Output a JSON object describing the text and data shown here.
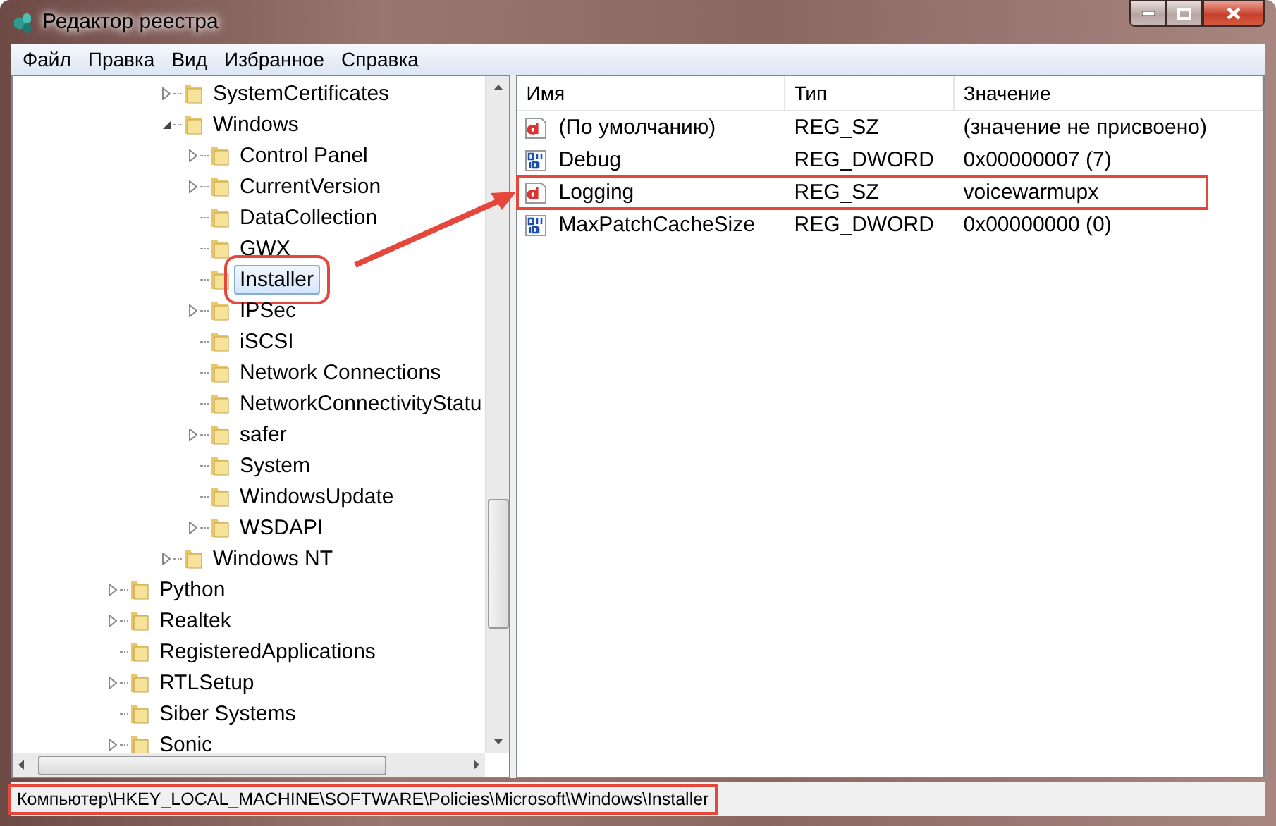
{
  "window": {
    "title": "Редактор реестра"
  },
  "menu": [
    "Файл",
    "Правка",
    "Вид",
    "Избранное",
    "Справка"
  ],
  "tree": {
    "items": [
      {
        "kind": "hidden",
        "children": [
          {
            "kind": "hidden",
            "children": [
              {
                "label": "SystemCertificates",
                "kind": "collapsed",
                "selected": false,
                "highlighted": false
              },
              {
                "label": "Windows",
                "kind": "expanded",
                "selected": false,
                "highlighted": false,
                "children": [
                  {
                    "label": "Control Panel",
                    "kind": "collapsed",
                    "selected": false,
                    "highlighted": false
                  },
                  {
                    "label": "CurrentVersion",
                    "kind": "collapsed",
                    "selected": false,
                    "highlighted": false
                  },
                  {
                    "label": "DataCollection",
                    "kind": "leaf",
                    "selected": false,
                    "highlighted": false
                  },
                  {
                    "label": "GWX",
                    "kind": "leaf",
                    "selected": false,
                    "highlighted": false
                  },
                  {
                    "label": "Installer",
                    "kind": "leaf",
                    "selected": true,
                    "highlighted": true
                  },
                  {
                    "label": "IPSec",
                    "kind": "collapsed",
                    "selected": false,
                    "highlighted": false
                  },
                  {
                    "label": "iSCSI",
                    "kind": "leaf",
                    "selected": false,
                    "highlighted": false
                  },
                  {
                    "label": "Network Connections",
                    "kind": "leaf",
                    "selected": false,
                    "highlighted": false
                  },
                  {
                    "label": "NetworkConnectivityStatu",
                    "kind": "leaf",
                    "selected": false,
                    "highlighted": false
                  },
                  {
                    "label": "safer",
                    "kind": "collapsed",
                    "selected": false,
                    "highlighted": false
                  },
                  {
                    "label": "System",
                    "kind": "leaf",
                    "selected": false,
                    "highlighted": false
                  },
                  {
                    "label": "WindowsUpdate",
                    "kind": "leaf",
                    "selected": false,
                    "highlighted": false
                  },
                  {
                    "label": "WSDAPI",
                    "kind": "collapsed",
                    "selected": false,
                    "highlighted": false
                  }
                ]
              },
              {
                "label": "Windows NT",
                "kind": "collapsed",
                "selected": false,
                "highlighted": false
              }
            ]
          }
        ]
      },
      {
        "label": "Python",
        "kind": "collapsed",
        "selected": false,
        "highlighted": false
      },
      {
        "label": "Realtek",
        "kind": "collapsed",
        "selected": false,
        "highlighted": false
      },
      {
        "label": "RegisteredApplications",
        "kind": "leaf",
        "selected": false,
        "highlighted": false
      },
      {
        "label": "RTLSetup",
        "kind": "collapsed",
        "selected": false,
        "highlighted": false
      },
      {
        "label": "Siber Systems",
        "kind": "leaf",
        "selected": false,
        "highlighted": false
      },
      {
        "label": "Sonic",
        "kind": "collapsed",
        "selected": false,
        "highlighted": false
      }
    ]
  },
  "values": {
    "columns": [
      "Имя",
      "Тип",
      "Значение"
    ],
    "rows": [
      {
        "kind": "string",
        "name": "(По умолчанию)",
        "type": "REG_SZ",
        "data": "(значение не присвоено)",
        "highlighted": false
      },
      {
        "kind": "dword",
        "name": "Debug",
        "type": "REG_DWORD",
        "data": "0x00000007 (7)",
        "highlighted": false
      },
      {
        "kind": "string",
        "name": "Logging",
        "type": "REG_SZ",
        "data": "voicewarmupx",
        "highlighted": true
      },
      {
        "kind": "dword",
        "name": "MaxPatchCacheSize",
        "type": "REG_DWORD",
        "data": "0x00000000 (0)",
        "highlighted": false
      }
    ]
  },
  "status_bar": {
    "path": "Компьютер\\HKEY_LOCAL_MACHINE\\SOFTWARE\\Policies\\Microsoft\\Windows\\Installer",
    "highlighted": true
  }
}
